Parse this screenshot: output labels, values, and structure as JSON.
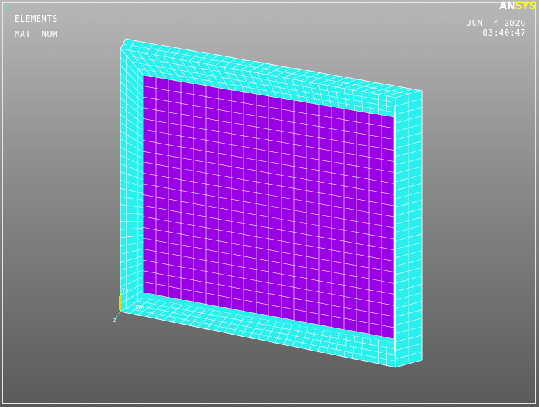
{
  "window": {
    "number": "1"
  },
  "labels": {
    "plot_type": "ELEMENTS",
    "plot_option": "MAT  NUM"
  },
  "datetime": {
    "date": "JUN  4 2026",
    "time": "03:40:47"
  },
  "logo": {
    "prefix": "AN",
    "suffix": "SYS"
  },
  "triad": {
    "y_label": "Y",
    "x_label": "X",
    "z_label": "Z",
    "origin_label": "W"
  },
  "colors": {
    "frame_material": "#29f0ec",
    "panel_material": "#9900e6",
    "mesh_lines": "#ffffff",
    "logo_suffix": "#ffff00",
    "window_number": "#00ffff"
  },
  "mesh": {
    "panel_columns": 20,
    "panel_rows": 20,
    "frame_segments_long": 32,
    "frame_segments_short": 4
  }
}
